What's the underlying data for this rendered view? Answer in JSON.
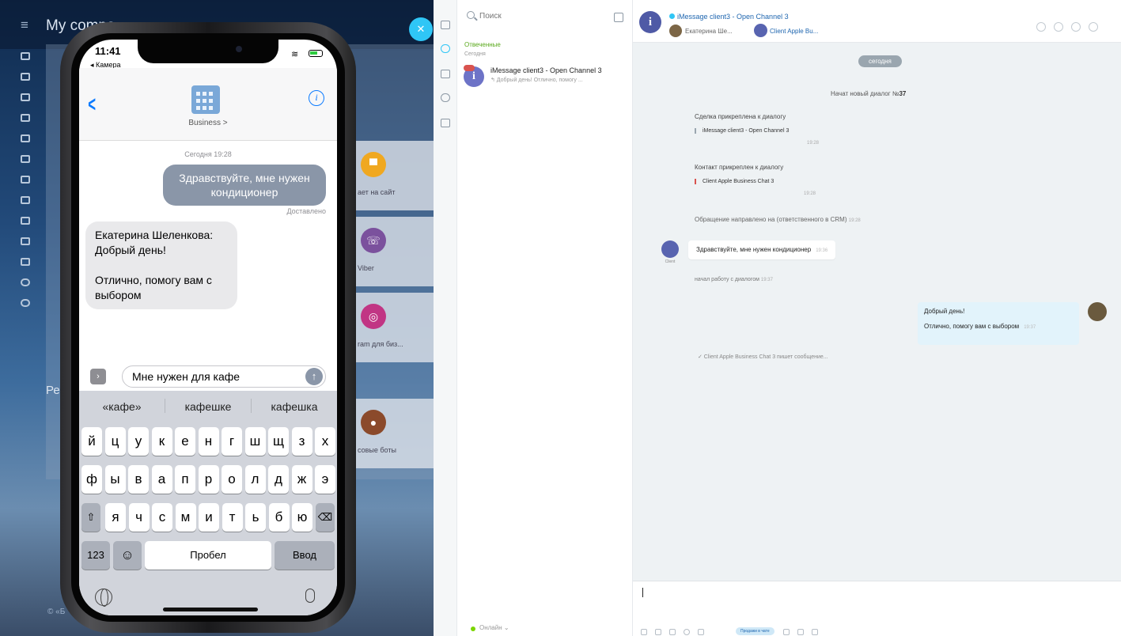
{
  "bg": {
    "portal_title": "My compa",
    "tiles": [
      {
        "label": "ает на сайт",
        "color": "#f0a820",
        "icon": "chat-icon"
      },
      {
        "label": "Viber",
        "color": "#7b519d",
        "icon": "viber-icon"
      },
      {
        "label": "ram для биз...",
        "color": "#c13584",
        "icon": "instagram-icon"
      },
      {
        "label": "совые боты",
        "color": "#8b4a2b",
        "icon": "mic-icon"
      }
    ],
    "re_label": "Ре",
    "footer": "© «Б"
  },
  "phone": {
    "time": "11:41",
    "back_app": "◂ Камера",
    "business_name": "Business >",
    "date": "Сегодня 19:28",
    "sent_bubble": "Здравствуйте, мне нужен кондиционер",
    "sent_status": "Доставлено",
    "received_lines": [
      "Екатерина Шеленкова:",
      " Добрый день!",
      "",
      "Отлично, помогу вам с выбором"
    ],
    "input_value": "Мне нужен для кафе",
    "suggestions": [
      "«кафе»",
      "кафешке",
      "кафешка"
    ],
    "keys_row1": [
      "й",
      "ц",
      "у",
      "к",
      "е",
      "н",
      "г",
      "ш",
      "щ",
      "з",
      "х"
    ],
    "keys_row2": [
      "ф",
      "ы",
      "в",
      "а",
      "п",
      "р",
      "о",
      "л",
      "д",
      "ж",
      "э"
    ],
    "keys_row3": [
      "я",
      "ч",
      "с",
      "м",
      "и",
      "т",
      "ь",
      "б",
      "ю"
    ],
    "key_123": "123",
    "key_emoji": "☺",
    "key_space": "Пробел",
    "key_return": "Ввод"
  },
  "openlines": {
    "search_placeholder": "Поиск",
    "section_title": "Отвеченные",
    "section_sub": "Сегодня",
    "chat_item": {
      "title": "iMessage client3 - Open Channel 3",
      "preview": "↰ Добрый день! Отлично, помогу ..."
    },
    "status": "Онлайн  ⌄",
    "header": {
      "title": "iMessage client3 - Open Channel 3",
      "operator": "Екатерина Ше...",
      "client": "Client Apple Bu..."
    },
    "date_pill": "сегодня",
    "sys_new_prefix": "Начат новый диалог №",
    "sys_new_number": "37",
    "deal_attached": "Сделка прикреплена к диалогу",
    "deal_quote": "iMessage client3 - Open Channel 3",
    "deal_time": "19:28",
    "contact_attached": "Контакт прикреплен к диалогу",
    "contact_quote": "Client Apple Business Chat 3",
    "contact_time": "19:28",
    "routed": "Обращение направлено на (ответственного в CRM)",
    "routed_time": "19:28",
    "client_label": "Client",
    "client_message": "Здравствуйте, мне нужен кондиционер",
    "client_message_time": "19:36",
    "started": "начал работу с диалогом",
    "started_time": "19:37",
    "op_line1": "Добрый день!",
    "op_line2": "Отлично, помогу вам с выбором",
    "op_time": "19:37",
    "typing": "✓ Client Apple Business Chat 3 пишет сообщение...",
    "hint_button": "Продажи в чате"
  }
}
